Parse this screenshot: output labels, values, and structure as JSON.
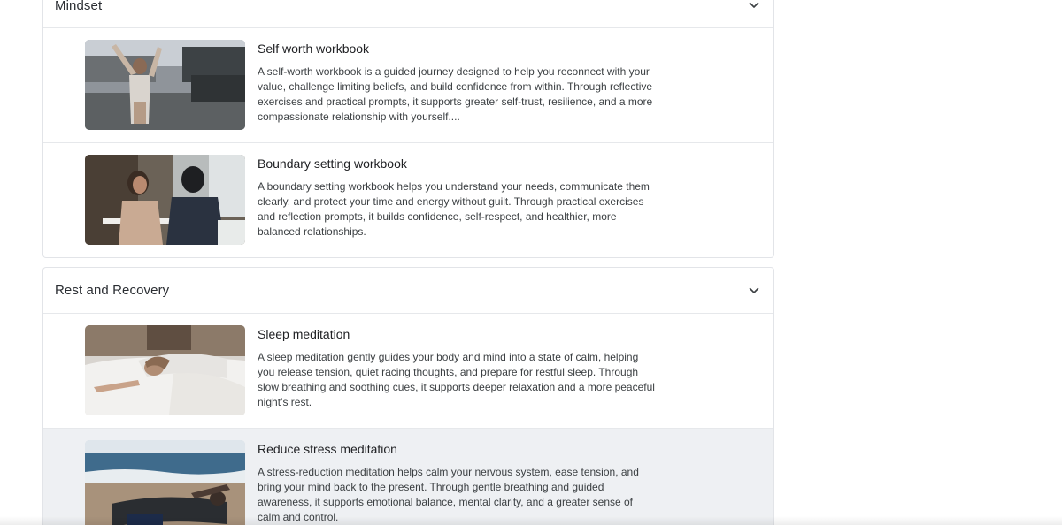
{
  "sections": [
    {
      "title": "Mindset",
      "chevron_icon": "chevron-down-icon",
      "items": [
        {
          "title": "Self worth workbook",
          "description": "A self-worth workbook is a guided journey designed to help you reconnect with your value, challenge limiting beliefs, and build confidence from within. Through reflective exercises and practical prompts, it supports greater self-trust, resilience, and a more compassionate relationship with yourself....",
          "image": "woman-stretching-outdoors-photo"
        },
        {
          "title": "Boundary setting workbook",
          "description": "A boundary setting workbook helps you understand your needs, communicate them clearly, and protect your time and energy without guilt. Through practical exercises and reflection prompts, it builds confidence, self-respect, and healthier, more balanced relationships.",
          "image": "two-women-conversation-photo"
        }
      ]
    },
    {
      "title": "Rest and Recovery",
      "chevron_icon": "chevron-down-icon",
      "items": [
        {
          "title": "Sleep meditation",
          "description": "A sleep meditation gently guides your body and mind into a state of calm, helping you release tension, quiet racing thoughts, and prepare for restful sleep. Through slow breathing and soothing cues, it supports deeper relaxation and a more peaceful night’s rest.",
          "image": "woman-sleeping-in-bed-photo"
        },
        {
          "title": "Reduce stress meditation",
          "description": "A stress-reduction meditation helps calm your nervous system, ease tension, and bring your mind back to the present. Through gentle breathing and guided awareness, it supports emotional balance, mental clarity, and a greater sense of calm and control.",
          "image": "person-resting-on-beach-photo"
        }
      ]
    }
  ],
  "colors": {
    "hover_row": "#eef0f3",
    "border": "#e2e4e8"
  }
}
